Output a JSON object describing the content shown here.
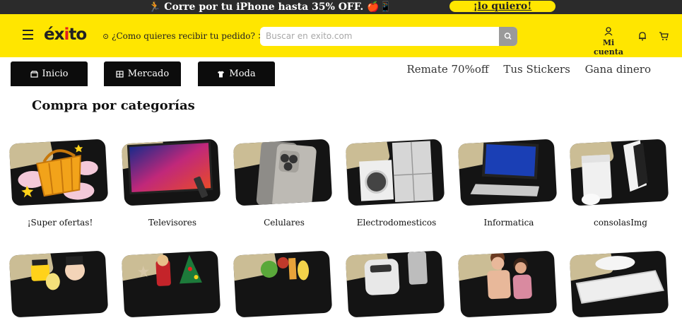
{
  "promo": {
    "text": "🏃 Corre por tu iPhone hasta 35% OFF. 🍎📱",
    "cta": "¡lo quiero!"
  },
  "header": {
    "logo": "éxito",
    "deliver_text": "¿Como quieres recibir tu pedido? >",
    "search_placeholder": "Buscar en exito.com",
    "account_label": "Mi cuenta"
  },
  "tabs": [
    {
      "label": "Inicio",
      "icon": "store-icon"
    },
    {
      "label": "Mercado",
      "icon": "grocery-icon"
    },
    {
      "label": "Moda",
      "icon": "shirt-icon"
    }
  ],
  "top_links": [
    "Remate 70%off",
    "Tus Stickers",
    "Gana dinero"
  ],
  "section_title": "Compra por categorías",
  "categories_row1": [
    {
      "label": "¡Super ofertas!",
      "icon": "shopping-basket-icon"
    },
    {
      "label": "Televisores",
      "icon": "tv-icon"
    },
    {
      "label": "Celulares",
      "icon": "smartphone-icon"
    },
    {
      "label": "Electrodomesticos",
      "icon": "appliances-icon"
    },
    {
      "label": "Informatica",
      "icon": "laptop-icon"
    },
    {
      "label": "consolasImg",
      "icon": "game-console-icon"
    }
  ],
  "categories_row2": [
    {
      "icon": "toys-icon"
    },
    {
      "icon": "christmas-decor-icon"
    },
    {
      "icon": "groceries-icon"
    },
    {
      "icon": "air-fryer-icon"
    },
    {
      "icon": "fashion-people-icon"
    },
    {
      "icon": "mattress-icon"
    }
  ],
  "colors": {
    "brand_yellow": "#ffe600",
    "promo_bg": "#2b2b2b",
    "tab_bg": "#0c0c0c",
    "logo_accent": "#e01e1e"
  }
}
